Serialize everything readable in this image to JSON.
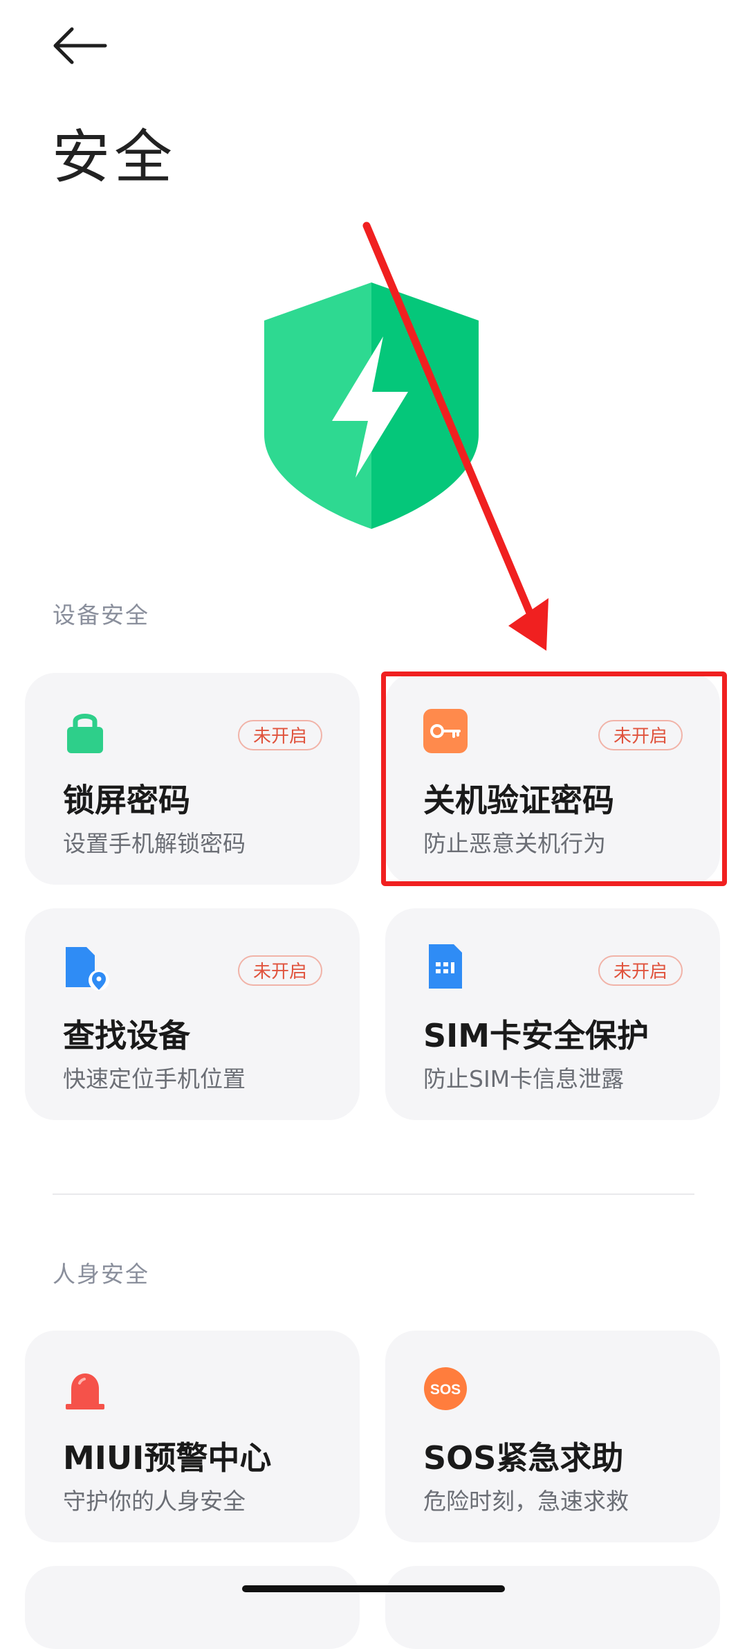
{
  "header": {
    "title": "安全"
  },
  "sections": {
    "device": {
      "label": "设备安全",
      "cards": [
        {
          "title": "锁屏密码",
          "subtitle": "设置手机解锁密码",
          "badge": "未开启",
          "icon": "lock-icon"
        },
        {
          "title": "关机验证密码",
          "subtitle": "防止恶意关机行为",
          "badge": "未开启",
          "icon": "key-icon"
        },
        {
          "title": "查找设备",
          "subtitle": "快速定位手机位置",
          "badge": "未开启",
          "icon": "find-device-icon"
        },
        {
          "title": "SIM卡安全保护",
          "subtitle": "防止SIM卡信息泄露",
          "badge": "未开启",
          "icon": "sim-card-icon"
        }
      ]
    },
    "personal": {
      "label": "人身安全",
      "cards": [
        {
          "title": "MIUI预警中心",
          "subtitle": "守护你的人身安全",
          "icon": "alarm-icon"
        },
        {
          "title": "SOS紧急求助",
          "subtitle": "危险时刻，急速求救",
          "icon": "sos-icon",
          "icon_text": "SOS"
        }
      ]
    }
  },
  "colors": {
    "shield_left": "#2ed991",
    "shield_right": "#05c77a",
    "lock": "#2ecf8a",
    "key": "#ff8a4c",
    "find": "#2f8cf5",
    "sim": "#2f8cf5",
    "alarm": "#f5524a",
    "sos": "#ff7d3d",
    "annotation": "#f02020"
  }
}
